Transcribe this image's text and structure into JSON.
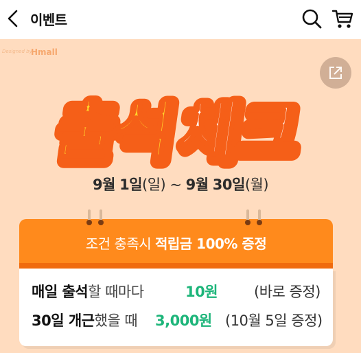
{
  "header": {
    "title": "이벤트",
    "back_icon": "chevron-left-icon",
    "search_icon": "search-icon",
    "cart_icon": "cart-icon"
  },
  "banner": {
    "background": "#ffdcbf",
    "designed_by": "Designed by",
    "brand": "Hmall",
    "headline_part1": "출석",
    "headline_part2": "체크",
    "date": {
      "start_month": "9월",
      "start_day": "1일",
      "start_weekday": "(일)",
      "separator": " ~ ",
      "end_month": "9월",
      "end_day": "30일",
      "end_weekday": "(월)"
    },
    "share_icon": "share-external-icon"
  },
  "card": {
    "heading_prefix": "조건 충족시 ",
    "heading_bold": "적립금 100% 증정",
    "rows": [
      {
        "label_bold": "매일 출석",
        "label_light": "할 때마다",
        "amount": "10원",
        "note": "(바로 증정)"
      },
      {
        "label_bold": "30일 개근",
        "label_light": "했을 때",
        "amount": "3,000원",
        "note": "(10월 5일 증정)"
      }
    ],
    "accent_color": "#ff8a1c",
    "amount_color": "#1db57a"
  }
}
